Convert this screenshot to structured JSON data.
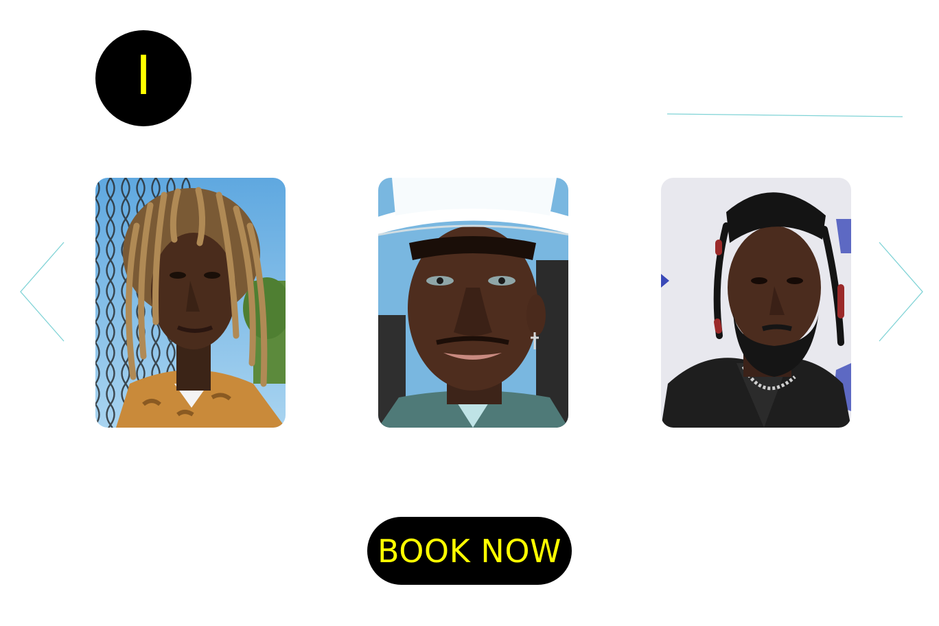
{
  "header": {
    "logo_letter": "I"
  },
  "carousel": {
    "prev_icon": "chevron-left-icon",
    "next_icon": "chevron-right-icon",
    "arrow_color": "#7fd3d6",
    "items": [
      {
        "name": "artist-portrait-1"
      },
      {
        "name": "artist-portrait-2"
      },
      {
        "name": "artist-portrait-3"
      }
    ]
  },
  "cta": {
    "label": "BOOK NOW"
  },
  "colors": {
    "accent": "#ffff00",
    "dark": "#000000",
    "line": "#7fd3d6"
  }
}
